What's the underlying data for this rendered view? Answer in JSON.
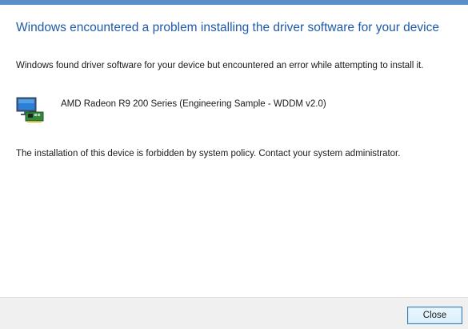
{
  "dialog": {
    "heading": "Windows encountered a problem installing the driver software for your device",
    "intro": "Windows found driver software for your device but encountered an error while attempting to install it.",
    "device": {
      "name": "AMD Radeon R9 200 Series (Engineering Sample - WDDM v2.0)",
      "icon": "display-adapter-icon"
    },
    "policy_message": "The installation of this device is forbidden by system policy. Contact your system administrator."
  },
  "footer": {
    "close_label": "Close"
  },
  "colors": {
    "heading": "#1e5aa8",
    "footer_bg": "#f0f0f0",
    "button_border": "#3c7fb1"
  }
}
